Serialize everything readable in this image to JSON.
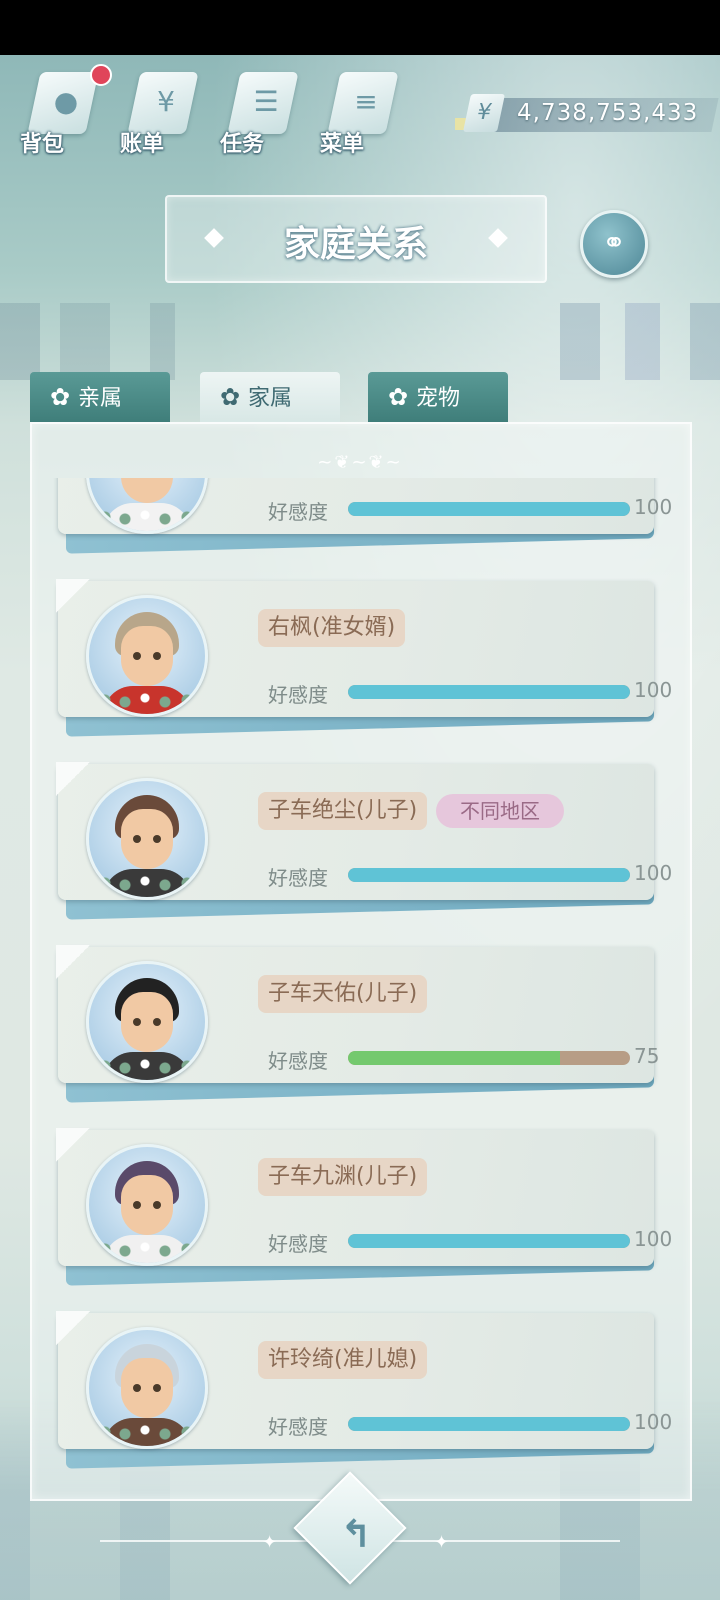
{
  "nav": {
    "bag_label": "背包",
    "bill_label": "账单",
    "task_label": "任务",
    "menu_label": "菜单"
  },
  "currency": {
    "symbol": "¥",
    "value": "4,738,753,433"
  },
  "title": "家庭关系",
  "tabs": [
    {
      "label": "亲属",
      "active": false
    },
    {
      "label": "家属",
      "active": true
    },
    {
      "label": "宠物",
      "active": false
    }
  ],
  "affinity_label": "好感度",
  "members": [
    {
      "name": "",
      "affinity": 100,
      "affinity_text": "100",
      "badge": "",
      "hair": "#8a3a32",
      "shirt": "#f2f2f2"
    },
    {
      "name": "右枫(准女婿)",
      "affinity": 100,
      "affinity_text": "100",
      "badge": "",
      "hair": "#b8a68a",
      "shirt": "#c8342c"
    },
    {
      "name": "子车绝尘(儿子)",
      "affinity": 100,
      "affinity_text": "100",
      "badge": "不同地区",
      "hair": "#6a4a3a",
      "shirt": "#3a3a3a"
    },
    {
      "name": "子车天佑(儿子)",
      "affinity": 75,
      "affinity_text": "75",
      "badge": "",
      "hair": "#222222",
      "shirt": "#3a3a3a"
    },
    {
      "name": "子车九渊(儿子)",
      "affinity": 100,
      "affinity_text": "100",
      "badge": "",
      "hair": "#5a4a6a",
      "shirt": "#f0f0f0"
    },
    {
      "name": "许玲绮(准儿媳)",
      "affinity": 100,
      "affinity_text": "100",
      "badge": "",
      "hair": "#c9d4dc",
      "shirt": "#6a4a3a"
    }
  ],
  "colors": {
    "bar_full": "#5fc3d6",
    "bar_partial": "#74c96e",
    "bar_track": "#b79d86"
  },
  "icons": {
    "bag": "bag-icon",
    "bill": "bill-icon",
    "task": "task-icon",
    "menu": "menu-icon",
    "relation": "family-tree-icon",
    "back": "back-arrow-icon"
  }
}
